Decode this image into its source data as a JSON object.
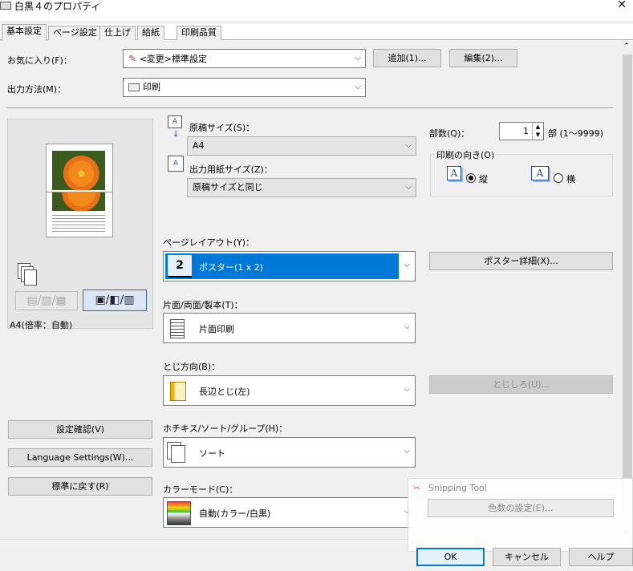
{
  "window": {
    "title": "白黒４のプロパティ",
    "close": "✕"
  },
  "tabs": [
    "基本設定",
    "ページ設定",
    "仕上げ",
    "給紙",
    "印刷品質"
  ],
  "favorites": {
    "label": "お気に入り(F)：",
    "value": "<変更>標準設定",
    "add_button": "追加(1)...",
    "edit_button": "編集(2)..."
  },
  "output": {
    "label": "出力方法(M)：",
    "value": "印刷"
  },
  "original_size": {
    "label": "原稿サイズ(S)：",
    "value": "A4"
  },
  "paper_size": {
    "label": "出力用紙サイズ(Z)：",
    "value": "原稿サイズと同じ"
  },
  "copies": {
    "label": "部数(Q)：",
    "value": "1",
    "unit": "部 (1～9999)"
  },
  "orientation": {
    "label": "印刷の向き(O)",
    "portrait": "縦",
    "landscape": "横",
    "selected": "portrait",
    "icon_letter": "A"
  },
  "page_layout": {
    "label": "ページレイアウト(Y)：",
    "value": "ポスター(1 x 2)",
    "detail_button": "ポスター詳細(X)...",
    "icon_text": "2"
  },
  "duplex": {
    "label": "片面/両面/製本(T)：",
    "value": "片面印刷"
  },
  "binding": {
    "label": "とじ方向(B)：",
    "value": "長辺とじ(左)",
    "margin_button": "とじしろ(U)..."
  },
  "finishing": {
    "label": "ホチキス/ソート/グループ(H)：",
    "value": "ソート"
  },
  "color_mode": {
    "label": "カラーモード(C)：",
    "value": "自動(カラー/白黒)",
    "color_count_button": "色数の設定(E)..."
  },
  "preview": {
    "caption": "A4(倍率：自動)"
  },
  "left_buttons": {
    "confirm": "設定確認(V)",
    "language": "Language Settings(W)...",
    "reset": "標準に戻す(R)"
  },
  "footer": {
    "ok": "OK",
    "cancel": "キャンセル",
    "help": "ヘルプ"
  },
  "snipping_tool": {
    "title": "Snipping Tool"
  },
  "colors": {
    "accent": "#0078d7",
    "dialog_bg": "#f0f0f0"
  }
}
